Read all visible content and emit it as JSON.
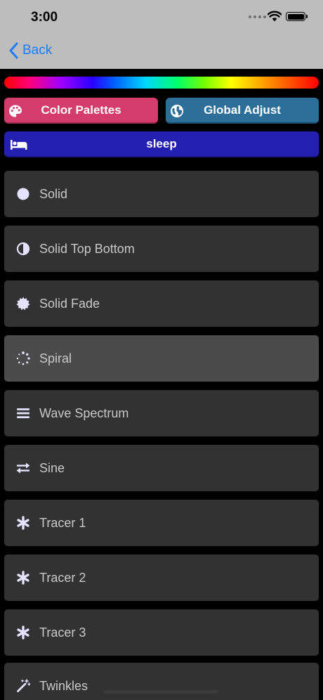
{
  "status_bar": {
    "time": "3:00"
  },
  "nav": {
    "back_label": "Back"
  },
  "buttons": {
    "palettes_label": "Color Palettes",
    "global_label": "Global Adjust",
    "sleep_label": "sleep"
  },
  "modes": [
    {
      "label": "Solid",
      "icon": "circle-icon",
      "selected": false
    },
    {
      "label": "Solid Top Bottom",
      "icon": "half-circle-icon",
      "selected": false
    },
    {
      "label": "Solid Fade",
      "icon": "certificate-icon",
      "selected": false
    },
    {
      "label": "Spiral",
      "icon": "spinner-icon",
      "selected": true
    },
    {
      "label": "Wave Spectrum",
      "icon": "bars-icon",
      "selected": false
    },
    {
      "label": "Sine",
      "icon": "exchange-icon",
      "selected": false
    },
    {
      "label": "Tracer 1",
      "icon": "asterisk-icon",
      "selected": false
    },
    {
      "label": "Tracer 2",
      "icon": "asterisk-icon",
      "selected": false
    },
    {
      "label": "Tracer 3",
      "icon": "asterisk-icon",
      "selected": false
    },
    {
      "label": "Twinkles",
      "icon": "magic-wand-icon",
      "selected": false
    }
  ],
  "colors": {
    "accent": "#1a7cff",
    "palettes_button": "#d43d6b",
    "global_button": "#2e6f99",
    "sleep_button": "#231fb0",
    "list_item": "#323232",
    "list_item_selected": "#4b4b4b",
    "icon_tint": "#e4e2ff"
  }
}
